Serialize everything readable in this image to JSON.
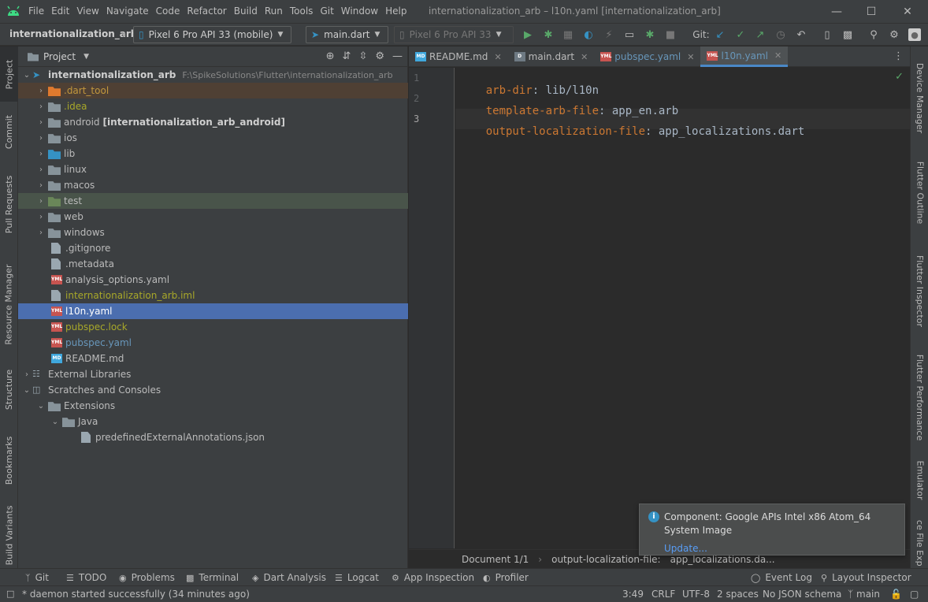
{
  "title_bar": {
    "menus": [
      "File",
      "Edit",
      "View",
      "Navigate",
      "Code",
      "Refactor",
      "Build",
      "Run",
      "Tools",
      "Git",
      "Window",
      "Help"
    ],
    "window_title": "internationalization_arb – l10n.yaml [internationalization_arb]"
  },
  "toolbar": {
    "project_name": "internationalization_arb",
    "device_selector": "Pixel 6 Pro API 33 (mobile)",
    "run_config": "main.dart",
    "device_selector_2": "Pixel 6 Pro API 33",
    "git_label": "Git:"
  },
  "left_strip": [
    "Project",
    "Commit",
    "Pull Requests",
    "Resource Manager",
    "Structure",
    "Bookmarks",
    "Build Variants"
  ],
  "right_strip": [
    "Device Manager",
    "Flutter Outline",
    "Flutter Inspector",
    "Flutter Performance",
    "Emulator",
    "Device File Explorer"
  ],
  "project_panel": {
    "title": "Project",
    "root_name": "internationalization_arb",
    "root_path": "F:\\SpikeSolutions\\Flutter\\internationalization_arb",
    "items": [
      {
        "label": ".dart_tool"
      },
      {
        "label": ".idea"
      },
      {
        "label": "android",
        "suffix": "[internationalization_arb_android]"
      },
      {
        "label": "ios"
      },
      {
        "label": "lib"
      },
      {
        "label": "linux"
      },
      {
        "label": "macos"
      },
      {
        "label": "test"
      },
      {
        "label": "web"
      },
      {
        "label": "windows"
      },
      {
        "label": ".gitignore"
      },
      {
        "label": ".metadata"
      },
      {
        "label": "analysis_options.yaml"
      },
      {
        "label": "internationalization_arb.iml"
      },
      {
        "label": "l10n.yaml"
      },
      {
        "label": "pubspec.lock"
      },
      {
        "label": "pubspec.yaml"
      },
      {
        "label": "README.md"
      },
      {
        "label": "External Libraries"
      },
      {
        "label": "Scratches and Consoles"
      },
      {
        "label": "Extensions"
      },
      {
        "label": "Java"
      },
      {
        "label": "predefinedExternalAnnotations.json"
      }
    ]
  },
  "editor": {
    "tabs": [
      "README.md",
      "main.dart",
      "pubspec.yaml",
      "l10n.yaml"
    ],
    "lines": [
      {
        "num": "1",
        "key": "arb-dir",
        "value": "lib/l10n"
      },
      {
        "num": "2",
        "key": "template-arb-file",
        "value": "app_en.arb"
      },
      {
        "num": "3",
        "key": "output-localization-file",
        "value": "app_localizations.dart"
      }
    ],
    "breadcrumbs": [
      "Document 1/1",
      "output-localization-file:",
      "app_localizations.da..."
    ]
  },
  "notification": {
    "message": "Component: Google APIs Intel x86 Atom_64 System Image",
    "link": "Update..."
  },
  "bottom_tabs": [
    "Git",
    "TODO",
    "Problems",
    "Terminal",
    "Dart Analysis",
    "Logcat",
    "App Inspection",
    "Profiler",
    "Event Log",
    "Layout Inspector"
  ],
  "status_bar": {
    "message": "* daemon started successfully (34 minutes ago)",
    "position": "3:49",
    "line_sep": "CRLF",
    "encoding": "UTF-8",
    "indent": "2 spaces",
    "schema": "No JSON schema",
    "branch": "main"
  },
  "colors": {
    "accent": "#4a88c7",
    "selection": "#4b6eaf",
    "key": "#cc7832",
    "value": "#a9b7c6"
  }
}
